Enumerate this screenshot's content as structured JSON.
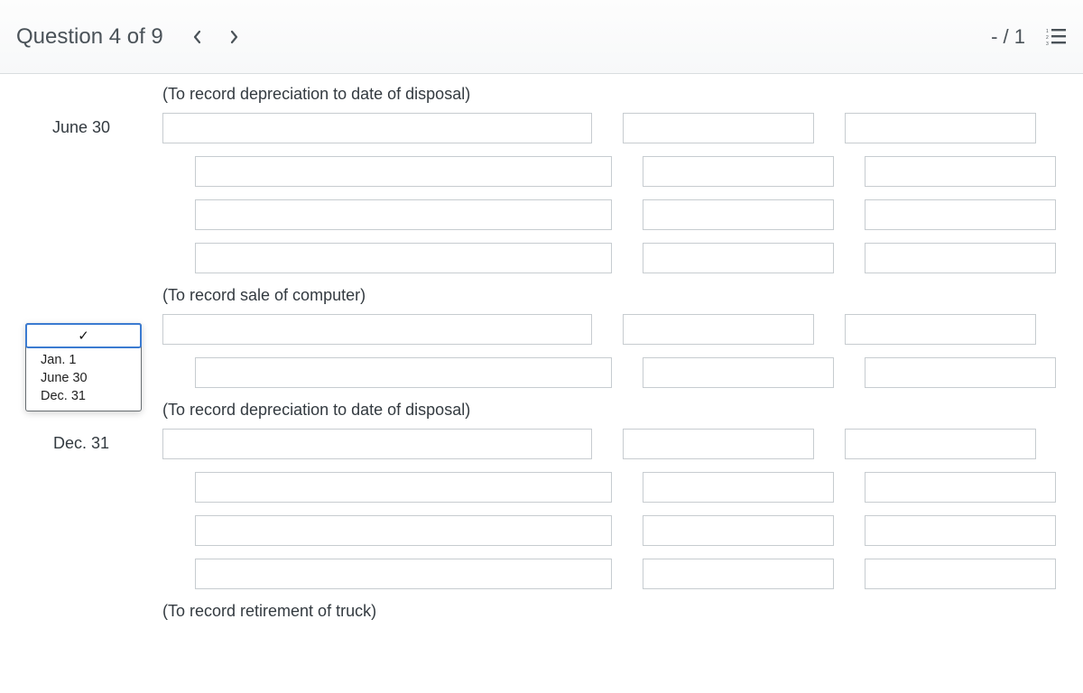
{
  "header": {
    "title": "Question 4 of 9",
    "score": "- / 1"
  },
  "notes": {
    "dep1": "(To record depreciation to date of disposal)",
    "sale": "(To record sale of computer)",
    "dep2": "(To record depreciation to date of disposal)",
    "retire": "(To record retirement of truck)"
  },
  "dates": {
    "june30": "June 30",
    "dec31": "Dec. 31"
  },
  "dropdown": {
    "selected_glyph": "✓",
    "options": [
      "Jan. 1",
      "June 30",
      "Dec. 31"
    ]
  }
}
